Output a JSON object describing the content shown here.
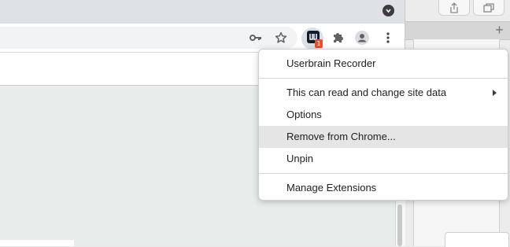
{
  "menu": {
    "title": "Userbrain Recorder",
    "items": [
      {
        "label": "This can read and change site data",
        "has_submenu": true
      },
      {
        "label": "Options"
      },
      {
        "label": "Remove from Chrome...",
        "highlighted": true
      },
      {
        "label": "Unpin"
      }
    ],
    "footer": "Manage Extensions"
  },
  "extension": {
    "badge": "1"
  },
  "colors": {
    "tabstrip": "#dee1e6",
    "badge": "#e3522c",
    "menu_hover": "#e5e5e5",
    "content": "#e8edec"
  },
  "icons": [
    "tab-search-icon",
    "key-icon",
    "star-icon",
    "userbrain-icon",
    "puzzle-icon",
    "profile-icon",
    "kebab-menu-icon",
    "share-icon",
    "tabs-icon",
    "plus-icon",
    "submenu-arrow-icon"
  ]
}
